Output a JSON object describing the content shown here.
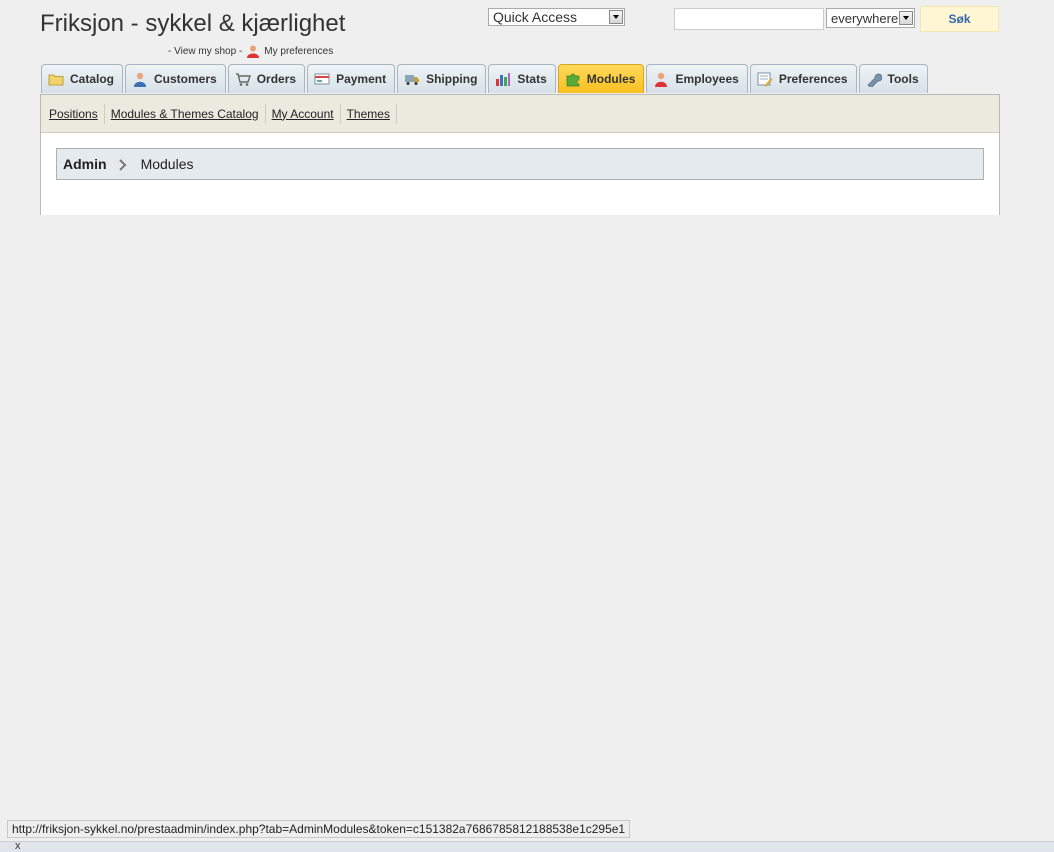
{
  "header": {
    "shop_title": "Friksjon - sykkel & kjærlighet",
    "view_shop_prefix": "- View my shop -",
    "preferences_label": "My preferences"
  },
  "quick_access": {
    "selected": "Quick Access"
  },
  "search": {
    "value": "",
    "scope": "everywhere",
    "button_label": "Søk"
  },
  "tabs": [
    {
      "label": "Catalog",
      "icon": "folder-icon"
    },
    {
      "label": "Customers",
      "icon": "customer-icon"
    },
    {
      "label": "Orders",
      "icon": "cart-icon"
    },
    {
      "label": "Payment",
      "icon": "payment-icon"
    },
    {
      "label": "Shipping",
      "icon": "truck-icon"
    },
    {
      "label": "Stats",
      "icon": "bar-chart-icon"
    },
    {
      "label": "Modules",
      "icon": "puzzle-icon",
      "active": true
    },
    {
      "label": "Employees",
      "icon": "employee-icon"
    },
    {
      "label": "Preferences",
      "icon": "preferences-icon"
    },
    {
      "label": "Tools",
      "icon": "wrench-icon"
    }
  ],
  "subtabs": [
    "Positions",
    "Modules & Themes Catalog",
    "My Account",
    "Themes"
  ],
  "breadcrumb": {
    "root": "Admin",
    "current": "Modules"
  },
  "status_bar": {
    "url": "http://friksjon-sykkel.no/prestaadmin/index.php?tab=AdminModules&token=c151382a7686785812188538e1c295e1"
  },
  "close_label": "x",
  "colors": {
    "active_tab": "#f8c021",
    "search_button_bg": "#fff6d3",
    "search_button_text": "#3366aa"
  }
}
